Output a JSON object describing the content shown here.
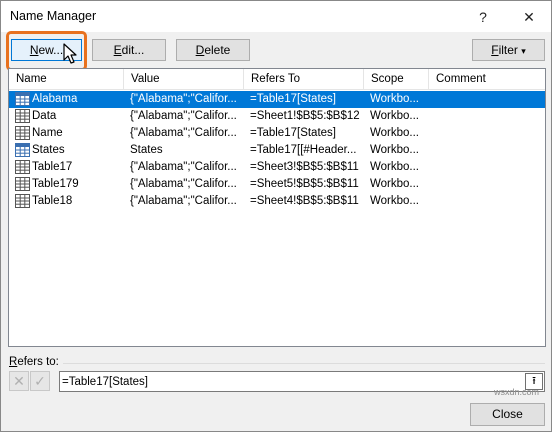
{
  "window": {
    "title": "Name Manager",
    "help_glyph": "?",
    "close_glyph": "✕"
  },
  "toolbar": {
    "new_label_u": "N",
    "new_label_rest": "ew...",
    "edit_label_u": "E",
    "edit_label_rest": "dit...",
    "delete_label_u": "D",
    "delete_label_rest": "elete",
    "filter_label_u": "F",
    "filter_label_rest": "ilter",
    "filter_caret": "▾"
  },
  "table": {
    "columns": [
      "Name",
      "Value",
      "Refers To",
      "Scope",
      "Comment"
    ],
    "rows": [
      {
        "name": "Alabama",
        "value": "{\"Alabama\";\"Califor...",
        "refers_to": "=Table17[States]",
        "scope": "Workbo...",
        "comment": "",
        "icon": "table-icon",
        "selected": true
      },
      {
        "name": "Data",
        "value": "{\"Alabama\";\"Califor...",
        "refers_to": "=Sheet1!$B$5:$B$12",
        "scope": "Workbo...",
        "comment": "",
        "icon": "range-icon",
        "selected": false
      },
      {
        "name": "Name",
        "value": "{\"Alabama\";\"Califor...",
        "refers_to": "=Table17[States]",
        "scope": "Workbo...",
        "comment": "",
        "icon": "range-icon",
        "selected": false
      },
      {
        "name": "States",
        "value": "States",
        "refers_to": "=Table17[[#Header...",
        "scope": "Workbo...",
        "comment": "",
        "icon": "table-icon",
        "selected": false
      },
      {
        "name": "Table17",
        "value": "{\"Alabama\";\"Califor...",
        "refers_to": "=Sheet3!$B$5:$B$11",
        "scope": "Workbo...",
        "comment": "",
        "icon": "range-icon",
        "selected": false
      },
      {
        "name": "Table179",
        "value": "{\"Alabama\";\"Califor...",
        "refers_to": "=Sheet5!$B$5:$B$11",
        "scope": "Workbo...",
        "comment": "",
        "icon": "range-icon",
        "selected": false
      },
      {
        "name": "Table18",
        "value": "{\"Alabama\";\"Califor...",
        "refers_to": "=Sheet4!$B$5:$B$11",
        "scope": "Workbo...",
        "comment": "",
        "icon": "range-icon",
        "selected": false
      }
    ]
  },
  "refers": {
    "label_u": "R",
    "label_rest": "efers to:",
    "value": "=Table17[States]",
    "cancel_glyph": "✕",
    "confirm_glyph": "✓",
    "collapse_glyph": "⭱"
  },
  "footer": {
    "close_label": "Close",
    "watermark": "wsxdn.com"
  },
  "colors": {
    "selection": "#0078d7",
    "highlight_ring": "#e8711e"
  }
}
